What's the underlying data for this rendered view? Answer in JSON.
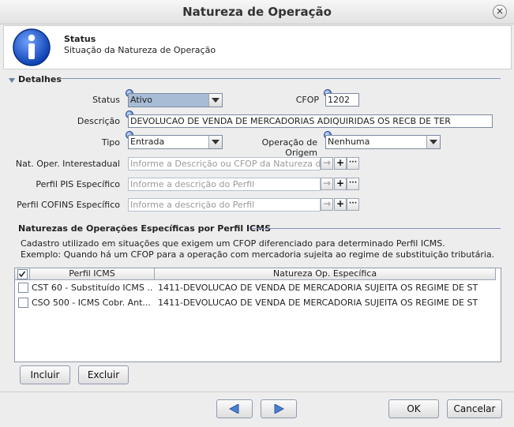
{
  "window": {
    "title": "Natureza de Operação",
    "close_label": "×"
  },
  "header": {
    "title": "Status",
    "subtitle": "Situação da Natureza de Operação",
    "icon": "info-icon"
  },
  "details": {
    "section_title": "Detalhes",
    "status_label": "Status",
    "status_value": "Ativo",
    "cfop_label": "CFOP",
    "cfop_value": "1202",
    "descricao_label": "Descrição",
    "descricao_value": "DEVOLUCAO DE VENDA DE MERCADORIAS ADIQUIRIDAS OS RECB DE TER",
    "tipo_label": "Tipo",
    "tipo_value": "Entrada",
    "origem_label": "Operação de Origem",
    "origem_value": "Nenhuma",
    "interestadual_label": "Nat. Oper. Interestadual",
    "interestadual_placeholder": "Informe a Descrição ou CFOP da Natureza de",
    "pis_label": "Perfil PIS Específico",
    "pis_placeholder": "Informe a descrição do Perfil",
    "cofins_label": "Perfil COFINS Específico",
    "cofins_placeholder": "Informe a descrição do Perfil",
    "go_symbol": "→",
    "plus_symbol": "+",
    "more_symbol": "···"
  },
  "icms": {
    "section_title": "Naturezas de Operações Específicas por Perfil ICMS",
    "desc_line1": "Cadastro utilizado em situações que exigem um CFOP diferenciado para determinado Perfil ICMS.",
    "desc_line2": "Exemplo: Quando há um CFOP para a operação com mercadoria sujeita ao regime de substituição tributária.",
    "columns": {
      "perfil": "Perfil ICMS",
      "natureza": "Natureza Op. Específica"
    },
    "rows": [
      {
        "perfil": "CST 60 - Substituído ICMS ...",
        "natureza": "1411-DEVOLUCAO DE VENDA DE MERCADORIA SUJEITA OS REGIME DE ST"
      },
      {
        "perfil": "CSO 500 - ICMS Cobr. Ant...",
        "natureza": "1411-DEVOLUCAO DE VENDA DE MERCADORIA SUJEITA OS REGIME DE ST"
      }
    ],
    "incluir_label": "Incluir",
    "excluir_label": "Excluir"
  },
  "footer": {
    "ok_label": "OK",
    "cancel_label": "Cancelar"
  },
  "colors": {
    "accent": "#2f5fb7",
    "section_line": "#7f96b8",
    "nav_arrow": "#4a7fd0"
  }
}
